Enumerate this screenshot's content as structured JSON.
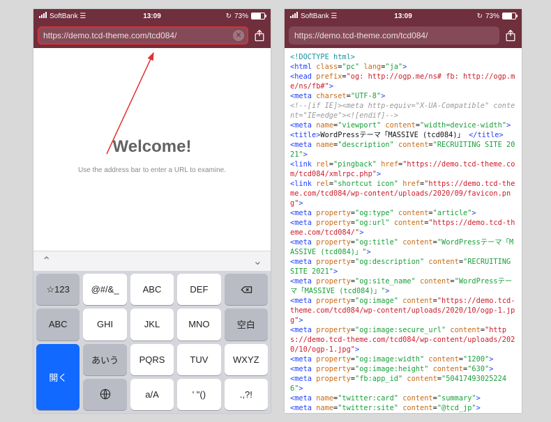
{
  "status": {
    "carrier": "SoftBank",
    "time": "13:09",
    "battery": "73%"
  },
  "left": {
    "url": "https://demo.tcd-theme.com/tcd084/",
    "welcome": "Welcome!",
    "hint": "Use the address bar to enter a URL to examine.",
    "kb_bar": {
      "up": "⌃",
      "down": "⌄"
    },
    "keys": {
      "r1": [
        "☆123",
        "@#/&_",
        "ABC",
        "DEF"
      ],
      "r2": [
        "ABC",
        "GHI",
        "JKL",
        "MNO",
        "空白"
      ],
      "r3": [
        "あいう",
        "PQRS",
        "TUV",
        "WXYZ",
        "開く"
      ],
      "r4": [
        "a/A",
        "' \"()",
        ".,?!"
      ]
    }
  },
  "right": {
    "url": "https://demo.tcd-theme.com/tcd084/",
    "code": {
      "l1a": "<!DOCTYPE html>",
      "l2_tag": "<html ",
      "l2_attr": "class",
      "l2_eq": "=",
      "l2_v": "\"pc\"",
      "l2_attr2": " lang",
      "l2_v2": "\"ja\"",
      "l2_end": ">",
      "l3_tag": "<head ",
      "l3_attr": "prefix",
      "l3_v": "\"og: http://ogp.me/ns# fb: http://ogp.me/ns/fb#\"",
      "l3_end": ">",
      "l4_tag": "<meta ",
      "l4_attr": "charset",
      "l4_v": "\"UTF-8\"",
      "l4_end": ">",
      "l5": "<!--[if IE]><meta http-equiv=\"X-UA-Compatible\" content=\"IE=edge\"><![endif]-->",
      "l6_tag": "<meta ",
      "l6_a1": "name",
      "l6_v1": "\"viewport\"",
      "l6_a2": " content",
      "l6_v2": "\"width=device-width\"",
      "l6_end": ">",
      "l7_tag": "<title>",
      "l7_txt": "WordPressテーマ「MASSIVE (tcd084)」 ",
      "l7_end": "</title>",
      "l8_tag": "<meta ",
      "l8_a1": "name",
      "l8_v1": "\"description\"",
      "l8_a2": " content",
      "l8_v2": "\"RECRUITING SITE 2021\"",
      "l8_end": ">",
      "l9_tag": "<link ",
      "l9_a1": "rel",
      "l9_v1": "\"pingback\"",
      "l9_a2": " href",
      "l9_v2": "\"https://demo.tcd-theme.com/tcd084/xmlrpc.php\"",
      "l9_end": ">",
      "l10_tag": "<link ",
      "l10_a1": "rel",
      "l10_v1": "\"shortcut icon\"",
      "l10_a2": " href",
      "l10_v2": "\"https://demo.tcd-theme.com/tcd084/wp-content/uploads/2020/09/favicon.png\"",
      "l10_end": ">",
      "l11_tag": "<meta ",
      "l11_a1": "property",
      "l11_v1": "\"og:type\"",
      "l11_a2": " content",
      "l11_v2": "\"article\"",
      "l11_end": ">",
      "l12_tag": "<meta ",
      "l12_a1": "property",
      "l12_v1": "\"og:url\"",
      "l12_a2": " content",
      "l12_v2": "\"https://demo.tcd-theme.com/tcd084/\"",
      "l12_end": ">",
      "l13_tag": "<meta ",
      "l13_a1": "property",
      "l13_v1": "\"og:title\"",
      "l13_a2": " content",
      "l13_v2": "\"WordPressテーマ「MASSIVE (tcd084)」\"",
      "l13_end": ">",
      "l14_tag": "<meta ",
      "l14_a1": "property",
      "l14_v1": "\"og:description\"",
      "l14_a2": " content",
      "l14_v2": "\"RECRUITING SITE 2021\"",
      "l14_end": ">",
      "l15_tag": "<meta ",
      "l15_a1": "property",
      "l15_v1": "\"og:site_name\"",
      "l15_a2": " content",
      "l15_v2": "\"WordPressテーマ「MASSIVE (tcd084)」\"",
      "l15_end": ">",
      "l16_tag": "<meta ",
      "l16_a1": "property",
      "l16_v1": "\"og:image\"",
      "l16_a2": " content",
      "l16_v2": "\"https://demo.tcd-theme.com/tcd084/wp-content/uploads/2020/10/ogp-1.jpg\"",
      "l16_end": ">",
      "l17_tag": "<meta ",
      "l17_a1": "property",
      "l17_v1": "\"og:image:secure_url\"",
      "l17_a2": " content",
      "l17_v2": "\"https://demo.tcd-theme.com/tcd084/wp-content/uploads/2020/10/ogp-1.jpg\"",
      "l17_end": ">",
      "l18_tag": "<meta ",
      "l18_a1": "property",
      "l18_v1": "\"og:image:width\"",
      "l18_a2": " content",
      "l18_v2": "\"1200\"",
      "l18_end": ">",
      "l19_tag": "<meta ",
      "l19_a1": "property",
      "l19_v1": "\"og:image:height\"",
      "l19_a2": " content",
      "l19_v2": "\"630\"",
      "l19_end": ">",
      "l20_tag": "<meta ",
      "l20_a1": "property",
      "l20_v1": "\"fb:app_id\"",
      "l20_a2": " content",
      "l20_v2": "\"504174930252246\"",
      "l20_end": ">",
      "l21_tag": "<meta ",
      "l21_a1": "name",
      "l21_v1": "\"twitter:card\"",
      "l21_a2": " content",
      "l21_v2": "\"summary\"",
      "l21_end": ">",
      "l22_tag": "<meta ",
      "l22_a1": "name",
      "l22_v1": "\"twitter:site\"",
      "l22_a2": " content",
      "l22_v2": "\"@tcd_jp\"",
      "l22_end": ">"
    }
  }
}
